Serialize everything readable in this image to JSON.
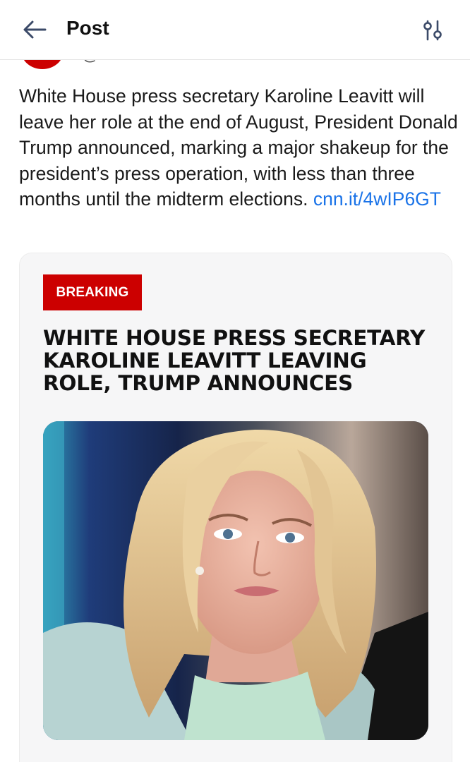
{
  "header": {
    "title": "Post",
    "back_icon": "arrow-left-icon",
    "options_icon": "tune-icon"
  },
  "author": {
    "handle": "@cnn.com",
    "avatar_color": "#cc0000"
  },
  "post": {
    "text": "White House press secretary Karoline Leavitt will leave her role at the end of August, President Donald Trump announced, marking a major shakeup for the president’s press operation, with less than three months until the midterm elections. ",
    "link": "cnn.it/4wIP6GT"
  },
  "card": {
    "badge": "BREAKING",
    "headline": "WHITE HOUSE PRESS SECRETARY KAROLINE LEAVITT LEAVING ROLE, TRUMP ANNOUNCES",
    "photo_subject": "portrait-photo"
  },
  "colors": {
    "breaking_red": "#cc0000",
    "link_blue": "#1a73e8",
    "card_bg": "#f6f6f7"
  }
}
